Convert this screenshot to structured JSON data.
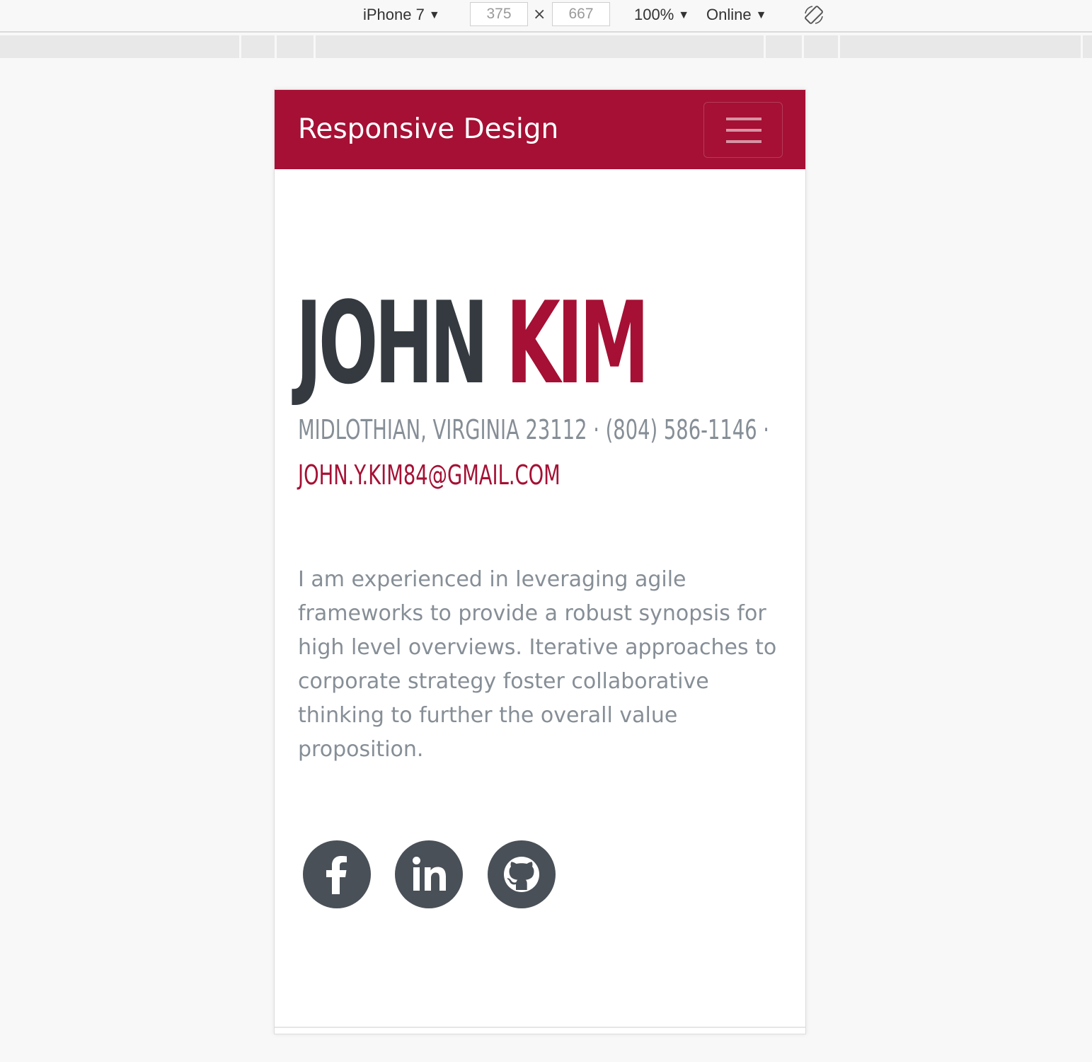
{
  "devtools": {
    "device": "iPhone 7",
    "width": "375",
    "height": "667",
    "times": "×",
    "zoom": "100%",
    "network": "Online"
  },
  "navbar": {
    "brand": "Responsive Design"
  },
  "hero": {
    "first_name": "JOHN",
    "last_name": "KIM",
    "address_line": "Midlothian, Virginia 23112 · (804) 586-1146 ·",
    "email": "john.y.kim84@gmail.com",
    "bio": "I am experienced in leveraging agile frameworks to provide a robust synopsis for high level overviews. Iterative approaches to corporate strategy foster collaborative thinking to further the overall value proposition."
  },
  "social": [
    "facebook-icon",
    "linkedin-icon",
    "github-icon"
  ],
  "colors": {
    "brand": "#a51034",
    "dark": "#343a40",
    "muted": "#868e96",
    "icon_bg": "#495057"
  }
}
